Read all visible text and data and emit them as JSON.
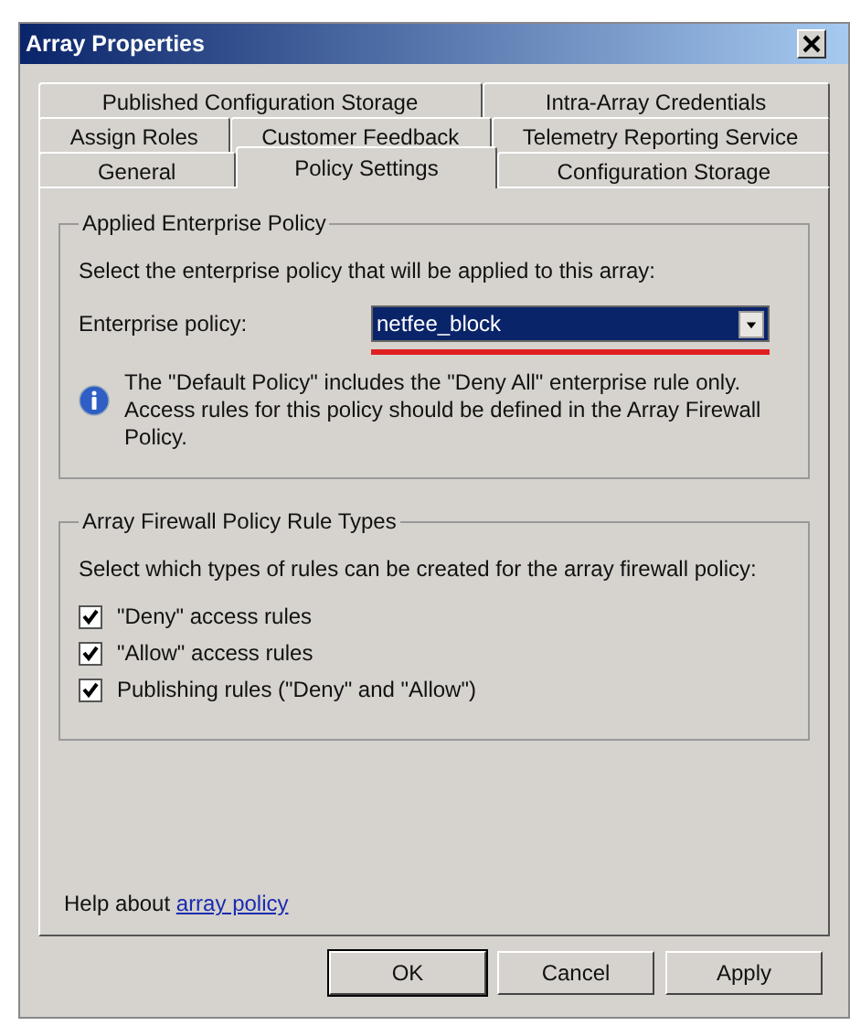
{
  "window": {
    "title": "Array Properties"
  },
  "tab_rows": [
    [
      {
        "label": "Published Configuration Storage",
        "selected": false
      },
      {
        "label": "Intra-Array Credentials",
        "selected": false
      }
    ],
    [
      {
        "label": "Assign Roles",
        "selected": false
      },
      {
        "label": "Customer Feedback",
        "selected": false
      },
      {
        "label": "Telemetry Reporting Service",
        "selected": false
      }
    ],
    [
      {
        "label": "General",
        "selected": false
      },
      {
        "label": "Policy Settings",
        "selected": true
      },
      {
        "label": "Configuration Storage",
        "selected": false
      }
    ]
  ],
  "enterprise_group": {
    "title": "Applied Enterprise Policy",
    "description": "Select the enterprise policy that will be applied to this array:",
    "field_label": "Enterprise policy:",
    "dropdown": {
      "value": "netfee_block"
    },
    "info": "The \"Default Policy\" includes the \"Deny All\" enterprise rule only. Access rules for this policy should be defined in the Array Firewall Policy."
  },
  "firewall_group": {
    "title": "Array Firewall Policy Rule Types",
    "description": "Select which types of rules can be created for the array firewall policy:",
    "options": [
      {
        "label": "\"Deny\" access rules",
        "checked": true
      },
      {
        "label": "\"Allow\" access rules",
        "checked": true
      },
      {
        "label": "Publishing rules (\"Deny\" and \"Allow\")",
        "checked": true
      }
    ]
  },
  "help": {
    "text": "Help about",
    "link": "array policy"
  },
  "buttons": [
    {
      "label": "OK",
      "default": true
    },
    {
      "label": "Cancel",
      "default": false
    },
    {
      "label": "Apply",
      "default": false
    }
  ]
}
